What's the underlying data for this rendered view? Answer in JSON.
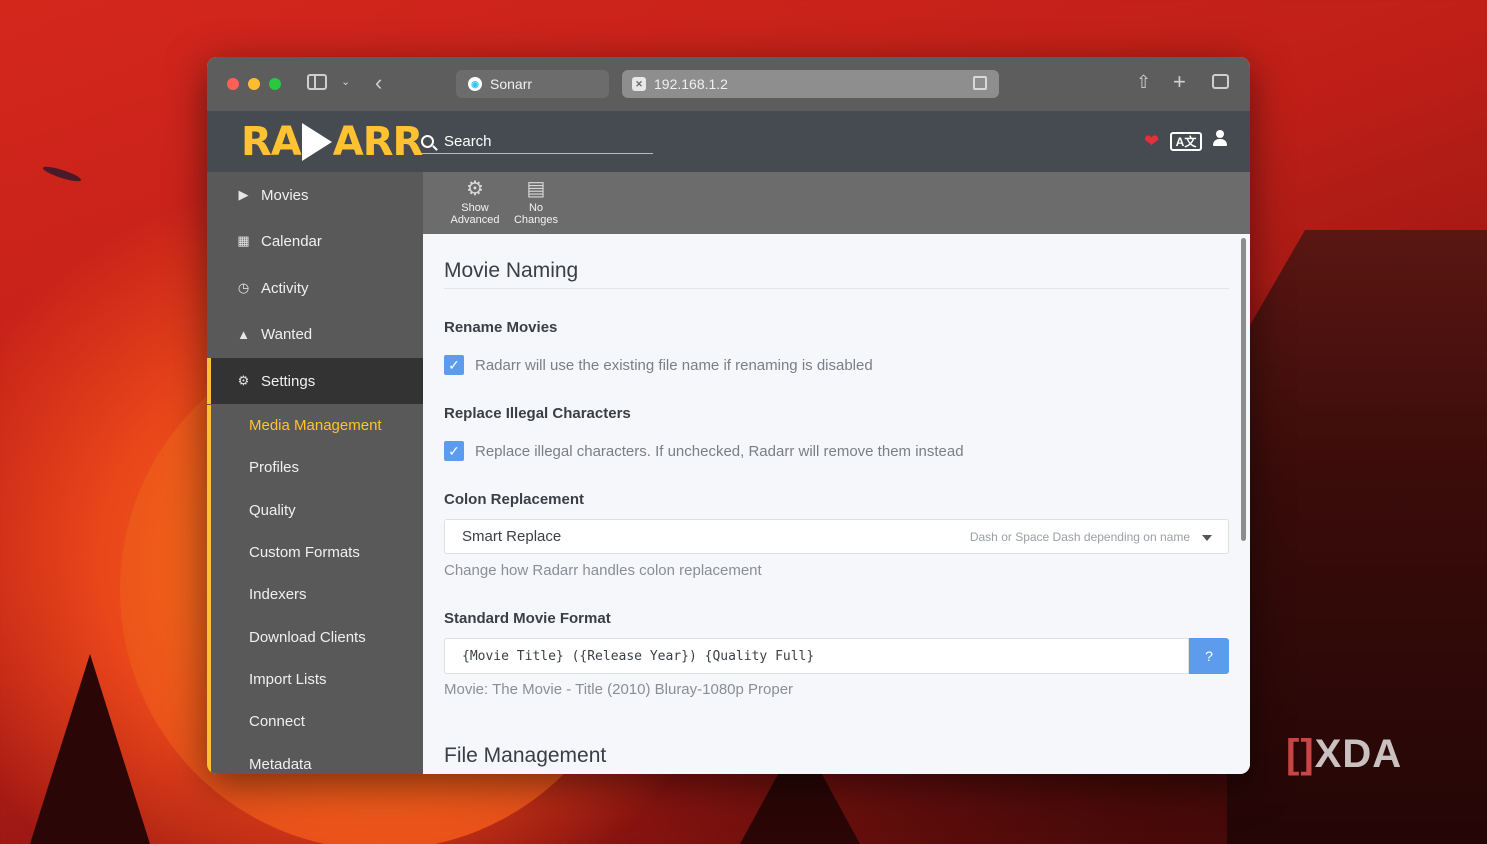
{
  "browser": {
    "tabs": [
      {
        "label": "Sonarr"
      },
      {
        "label": "192.168.1.2"
      }
    ]
  },
  "app": {
    "logo_text_left": "RA",
    "logo_text_right": "ARR",
    "search_placeholder": "Search",
    "translate_icon_text": "A文"
  },
  "toolbar": {
    "show_advanced_line1": "Show",
    "show_advanced_line2": "Advanced",
    "no_changes_line1": "No",
    "no_changes_line2": "Changes"
  },
  "sidebar": {
    "items": [
      {
        "label": "Movies",
        "icon": "play-icon"
      },
      {
        "label": "Calendar",
        "icon": "calendar-icon"
      },
      {
        "label": "Activity",
        "icon": "clock-icon"
      },
      {
        "label": "Wanted",
        "icon": "warning-icon"
      },
      {
        "label": "Settings",
        "icon": "gears-icon"
      }
    ],
    "settings_subitems": [
      {
        "label": "Media Management",
        "active": true
      },
      {
        "label": "Profiles"
      },
      {
        "label": "Quality"
      },
      {
        "label": "Custom Formats"
      },
      {
        "label": "Indexers"
      },
      {
        "label": "Download Clients"
      },
      {
        "label": "Import Lists"
      },
      {
        "label": "Connect"
      },
      {
        "label": "Metadata"
      }
    ]
  },
  "content": {
    "movie_naming_title": "Movie Naming",
    "rename_movies_label": "Rename Movies",
    "rename_movies_checked": true,
    "rename_movies_text": "Radarr will use the existing file name if renaming is disabled",
    "replace_illegal_label": "Replace Illegal Characters",
    "replace_illegal_checked": true,
    "replace_illegal_text": "Replace illegal characters. If unchecked, Radarr will remove them instead",
    "colon_label": "Colon Replacement",
    "colon_value": "Smart Replace",
    "colon_hint": "Dash or Space Dash depending on name",
    "colon_help": "Change how Radarr handles colon replacement",
    "format_label": "Standard Movie Format",
    "format_value": "{Movie Title} ({Release Year}) {Quality Full}",
    "format_help_button": "?",
    "format_example": "Movie: The Movie - Title (2010) Bluray-1080p Proper",
    "file_management_title": "File Management"
  },
  "watermark": {
    "bracket": "[]",
    "text": "XDA"
  },
  "colors": {
    "accent": "#ffc230",
    "header": "#464b51",
    "sidebar": "#595959",
    "checkbox": "#5d9cec",
    "heart": "#e5303a"
  }
}
